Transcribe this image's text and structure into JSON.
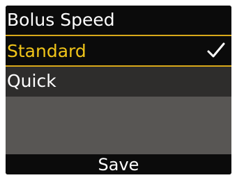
{
  "title": "Bolus Speed",
  "options": [
    {
      "label": "Standard",
      "selected": true
    },
    {
      "label": "Quick",
      "selected": false
    }
  ],
  "softkey": {
    "save_label": "Save"
  },
  "colors": {
    "highlight_text": "#f0c419",
    "highlight_border": "#d9a91a",
    "background": "#585654"
  },
  "icons": {
    "selected": "check-icon"
  }
}
